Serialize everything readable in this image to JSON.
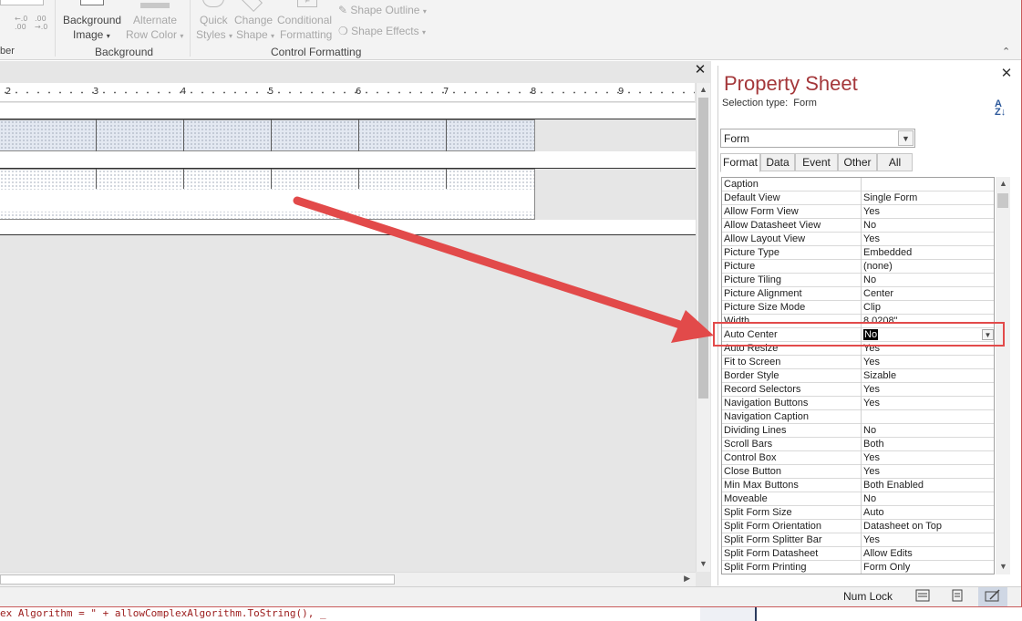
{
  "ribbon": {
    "number_group": "ber",
    "decimal_increase": "←.0\n.00",
    "decimal_decrease": ".00\n→.0",
    "background_image_line1": "Background",
    "background_image_line2": "Image",
    "alternate_row_color_line1": "Alternate",
    "alternate_row_color_line2": "Row Color",
    "background_group": "Background",
    "quick_styles_line1": "Quick",
    "quick_styles_line2": "Styles",
    "change_shape_line1": "Change",
    "change_shape_line2": "Shape",
    "conditional_formatting_line1": "Conditional",
    "conditional_formatting_line2": "Formatting",
    "shape_outline": "Shape Outline",
    "shape_effects": "Shape Effects",
    "control_formatting_group": "Control Formatting"
  },
  "design": {
    "ruler_numbers": [
      "2",
      "3",
      "4",
      "5",
      "6",
      "7",
      "8",
      "9"
    ]
  },
  "property_sheet": {
    "title": "Property Sheet",
    "selection_type_label": "Selection type:",
    "selection_type_value": "Form",
    "sort_icon_text": "A\nZ",
    "object_combo": "Form",
    "tabs": [
      "Format",
      "Data",
      "Event",
      "Other",
      "All"
    ],
    "rows": [
      {
        "k": "Caption",
        "v": ""
      },
      {
        "k": "Default View",
        "v": "Single Form"
      },
      {
        "k": "Allow Form View",
        "v": "Yes"
      },
      {
        "k": "Allow Datasheet View",
        "v": "No"
      },
      {
        "k": "Allow Layout View",
        "v": "Yes"
      },
      {
        "k": "Picture Type",
        "v": "Embedded"
      },
      {
        "k": "Picture",
        "v": "(none)"
      },
      {
        "k": "Picture Tiling",
        "v": "No"
      },
      {
        "k": "Picture Alignment",
        "v": "Center"
      },
      {
        "k": "Picture Size Mode",
        "v": "Clip"
      },
      {
        "k": "Width",
        "v": "8.0208\""
      },
      {
        "k": "Auto Center",
        "v": "No"
      },
      {
        "k": "Auto Resize",
        "v": "Yes"
      },
      {
        "k": "Fit to Screen",
        "v": "Yes"
      },
      {
        "k": "Border Style",
        "v": "Sizable"
      },
      {
        "k": "Record Selectors",
        "v": "Yes"
      },
      {
        "k": "Navigation Buttons",
        "v": "Yes"
      },
      {
        "k": "Navigation Caption",
        "v": ""
      },
      {
        "k": "Dividing Lines",
        "v": "No"
      },
      {
        "k": "Scroll Bars",
        "v": "Both"
      },
      {
        "k": "Control Box",
        "v": "Yes"
      },
      {
        "k": "Close Button",
        "v": "Yes"
      },
      {
        "k": "Min Max Buttons",
        "v": "Both Enabled"
      },
      {
        "k": "Moveable",
        "v": "No"
      },
      {
        "k": "Split Form Size",
        "v": "Auto"
      },
      {
        "k": "Split Form Orientation",
        "v": "Datasheet on Top"
      },
      {
        "k": "Split Form Splitter Bar",
        "v": "Yes"
      },
      {
        "k": "Split Form Datasheet",
        "v": "Allow Edits"
      },
      {
        "k": "Split Form Printing",
        "v": "Form Only"
      }
    ],
    "selected_index": 11
  },
  "status": {
    "num_lock": "Num Lock"
  },
  "code_line": "ex Algorithm = \" + allowComplexAlgorithm.ToString(), _",
  "colors": {
    "title": "#a4373a",
    "arrow": "#e24a4a",
    "highlight": "#e24a4a"
  }
}
